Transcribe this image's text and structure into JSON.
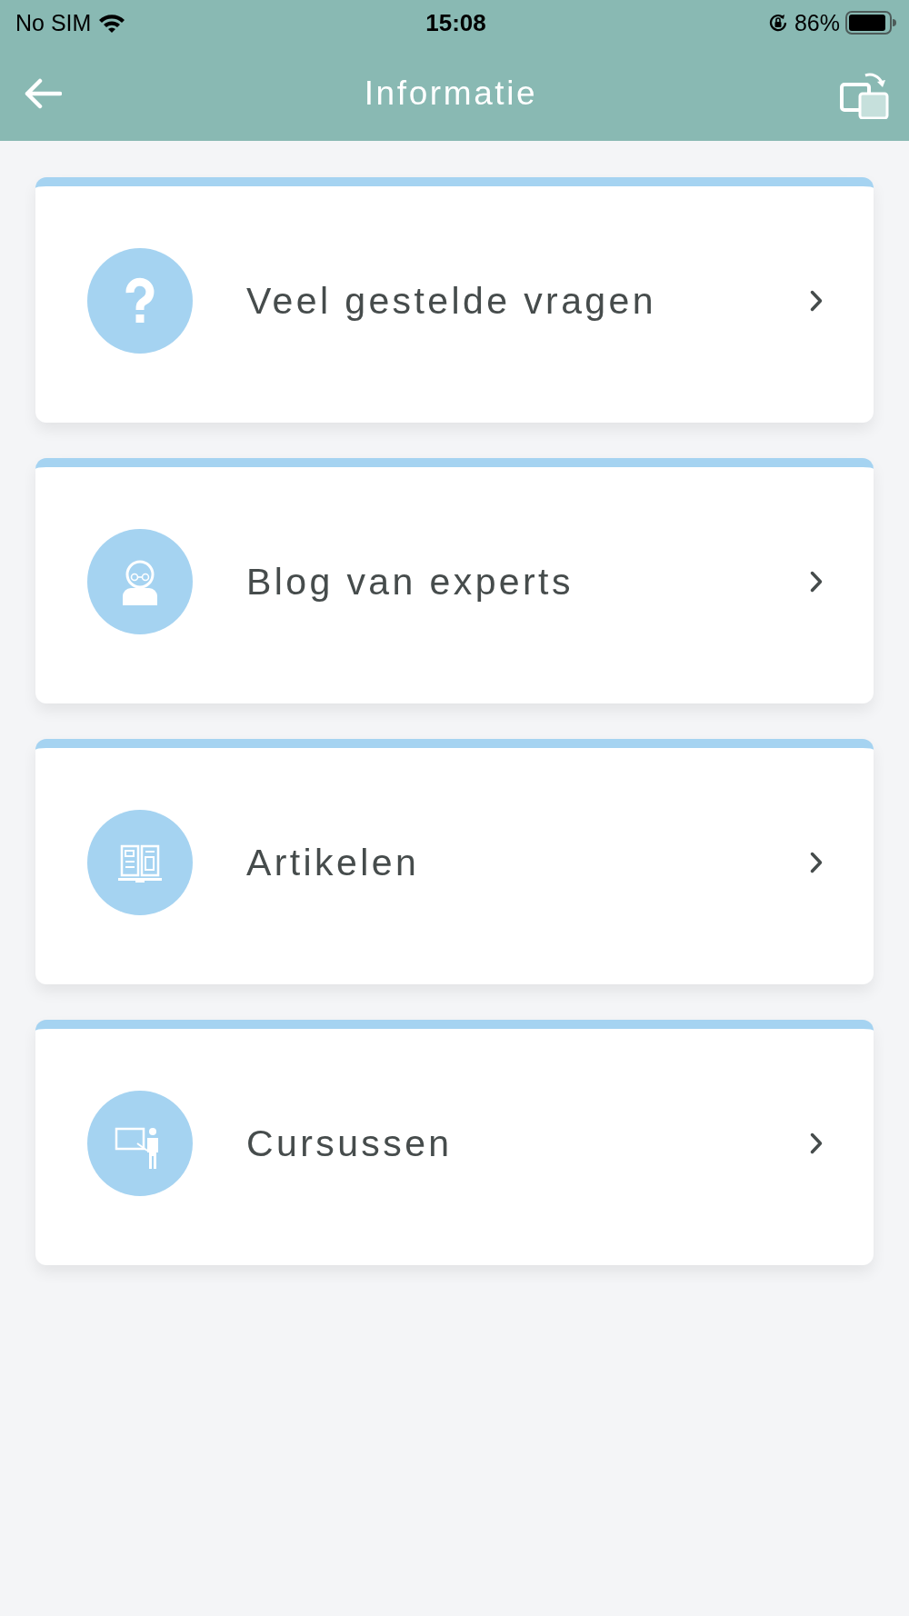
{
  "status_bar": {
    "carrier": "No SIM",
    "time": "15:08",
    "battery": "86%"
  },
  "header": {
    "title": "Informatie"
  },
  "items": [
    {
      "label": "Veel gestelde vragen",
      "kind": "question"
    },
    {
      "label": "Blog van experts",
      "kind": "expert"
    },
    {
      "label": "Artikelen",
      "kind": "book"
    },
    {
      "label": "Cursussen",
      "kind": "teacher"
    }
  ]
}
